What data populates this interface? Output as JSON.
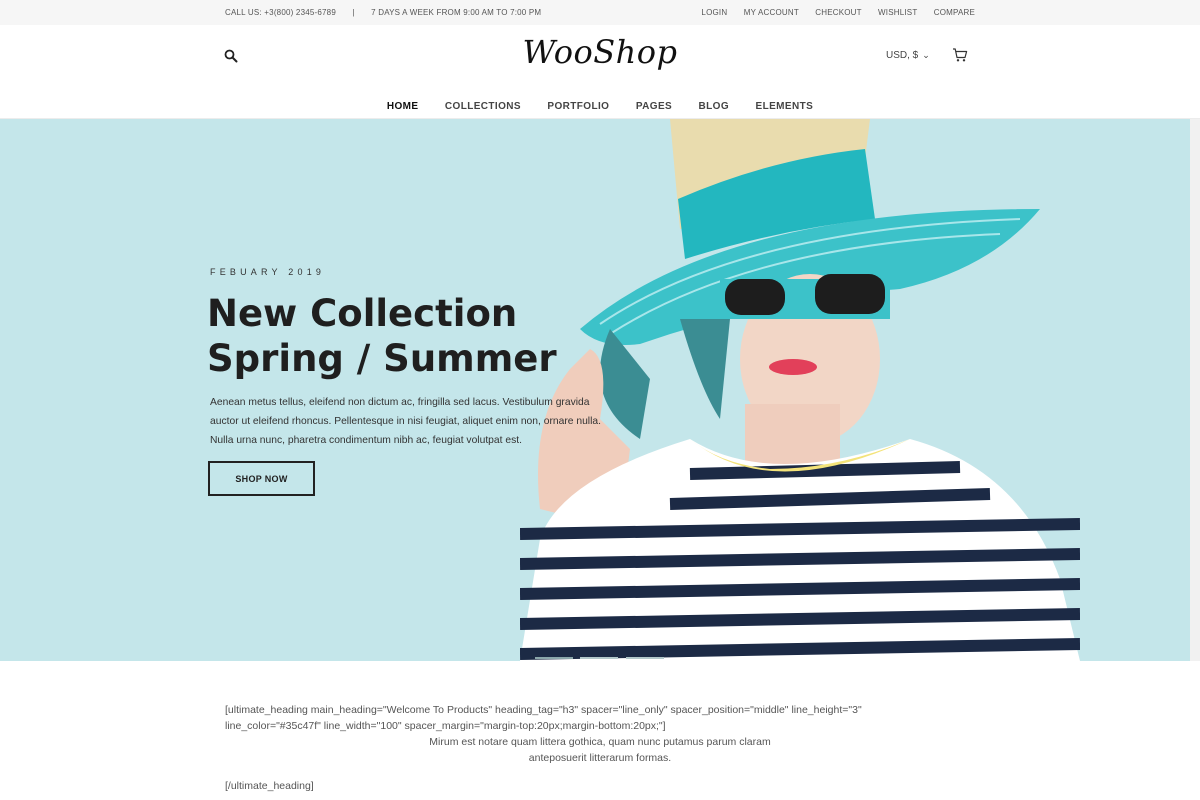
{
  "topbar": {
    "call": "CALL US: +3(800) 2345-6789",
    "separator": "|",
    "hours": "7 DAYS A WEEK FROM 9:00 AM TO 7:00 PM",
    "links": [
      "LOGIN",
      "MY ACCOUNT",
      "CHECKOUT",
      "WISHLIST",
      "COMPARE"
    ]
  },
  "header": {
    "logo": "WooShop",
    "currency": "USD, $",
    "search_icon": "search-icon",
    "cart_icon": "cart-icon"
  },
  "nav": {
    "items": [
      "HOME",
      "COLLECTIONS",
      "PORTFOLIO",
      "PAGES",
      "BLOG",
      "ELEMENTS"
    ],
    "active": "HOME"
  },
  "hero": {
    "date": "FEBUARY 2019",
    "title_line1": "New Collection",
    "title_line2": "Spring / Summer",
    "description": "Aenean metus tellus, eleifend non dictum ac, fringilla sed lacus. Vestibulum gravida auctor ut eleifend rhoncus. Pellentesque in nisi feugiat, aliquet enim non, ornare nulla. Nulla urna nunc, pharetra condimentum nibh ac, feugiat volutpat est.",
    "button": "SHOP NOW",
    "slides": 3,
    "active_slide": 1,
    "background": "#c4e6ea"
  },
  "content": {
    "shortcode_open": "[ultimate_heading main_heading=\"Welcome To Products\" heading_tag=\"h3\" spacer=\"line_only\" spacer_position=\"middle\" line_height=\"3\" line_color=\"#35c47f\" line_width=\"100\" spacer_margin=\"margin-top:20px;margin-bottom:20px;\"]",
    "sub_line1": "Mirum est notare quam littera gothica, quam nunc putamus parum claram",
    "sub_line2": "anteposuerit litterarum formas.",
    "shortcode_close": "[/ultimate_heading]"
  }
}
